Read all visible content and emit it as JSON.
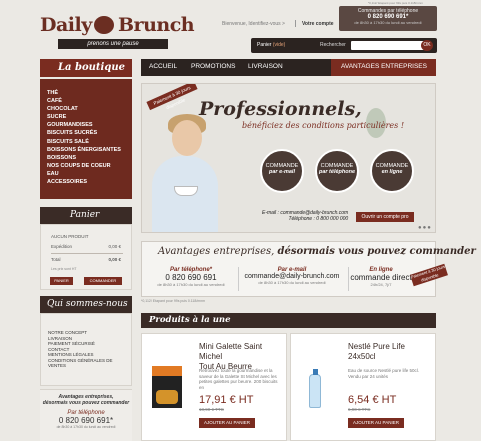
{
  "header": {
    "logo_word1": "Daily",
    "logo_word2": "Brunch",
    "logo_tagline": "prenons une pause",
    "greeting": "Bienvenue, Identifiez-vous >",
    "account_link": "Votre compte",
    "phone_box": {
      "note": "*0,112/ Etapant pour 99s puis 0.118/mnm",
      "title": "Commandes par téléphone",
      "phone": "0 820 690 691*",
      "hours": "de 8h30 à 17h30 du lundi au vendredi"
    },
    "cart_label": "Panier",
    "cart_state": "(vide)",
    "search_label": "Rechercher",
    "search_placeholder": "",
    "search_button": "OK"
  },
  "sidebar": {
    "boutique_title": "La boutique",
    "categories": [
      "THÉ",
      "CAFÉ",
      "CHOCOLAT",
      "SUCRE",
      "GOURMANDISES",
      "BISCUITS SUCRÉS",
      "BISCUITS SALÉ",
      "BOISSONS ÉNERGISANTES",
      "BOISSONS",
      "NOS COUPS DE COEUR",
      "EAU",
      "ACCESSOIRES"
    ],
    "panier_title": "Panier",
    "panier": {
      "product_line": "AUCUN PRODUIT",
      "shipping_label": "Expédition",
      "shipping_value": "0,00 €",
      "total_label": "Total",
      "total_value": "0,00 €",
      "tax_note": "Les prix sont HT",
      "btn_panier": "PANIER",
      "btn_commander": "COMMANDER"
    },
    "qui_title": "Qui sommes-nous",
    "qui_links": [
      "NOTRE CONCEPT",
      "LIVRAISON",
      "PAIEMENT SÉCURISÉ",
      "CONTACT",
      "MENTIONS LÉGALES",
      "CONDITIONS GÉNÉRALES DE",
      "VENTES"
    ],
    "adv": {
      "line1": "Avantages entreprises,",
      "line2": "désormais vous pouvez commander",
      "phone_label": "Par téléphone",
      "phone": "0 820 690 691*",
      "hours": "de 8h30 à 17h30 du lundi au vendredi"
    }
  },
  "nav": {
    "items": [
      "ACCUEIL",
      "PROMOTIONS",
      "LIVRAISON"
    ],
    "entreprises": "AVANTAGES ENTREPRISES"
  },
  "hero": {
    "ribbon": "Paiement à 30 jours disponible",
    "title": "Professionnels,",
    "subtitle": "bénéficiez des conditions particulières !",
    "circles": [
      {
        "top": "COMMANDE",
        "bottom": "par e-mail"
      },
      {
        "top": "COMMANDE",
        "bottom": "par téléphone"
      },
      {
        "top": "COMMANDE",
        "bottom": "en ligne"
      }
    ],
    "email_line": "E-mail : commande@daily-brunch.com",
    "phone_line": "Téléphone : 0 800 000 000",
    "button": "Ouvrir un compte pro",
    "dots": "●●●"
  },
  "advantages": {
    "title_part1": "Avantages entreprises,",
    "title_part2": "désormais vous pouvez commander",
    "columns": [
      {
        "label": "Par téléphone*",
        "value": "0 820 690 691",
        "sub": "de 8h30 à 17h30 du lundi au vendredi"
      },
      {
        "label": "Par e-mail",
        "value": "commande@daily-brunch.com",
        "sub": "de 8h30 à 17h30 du lundi au vendredi"
      },
      {
        "label": "En ligne",
        "value": "commande direct",
        "sub": "24h/24, 7j/7"
      }
    ],
    "note": "*0,112/ Etapant pour 99s puis 0.118/mnm",
    "badge": "Paiement à 30 jours disponible"
  },
  "products": {
    "title": "Produits à la une",
    "items": [
      {
        "name_line1": "Mini Galette Saint Michel",
        "name_line2": "Tout Au Beurre",
        "desc": "Retrouvez toute la gourmandise et la saveur de la Galette St Michel avec les petites galettes pur beurre. 200 biscuits en",
        "price": "17,91 € HT",
        "old_price": "18,90 € TTC",
        "button": "AJOUTER AU PANIER"
      },
      {
        "name_line1": "Nestlé Pure Life",
        "name_line2": "24x50cl",
        "desc": "Eau de source Nestlé pure life 50cl. Vendu par 24 unités",
        "price": "6,54 € HT",
        "old_price": "6,90 € TTC",
        "button": "AJOUTER AU PANIER"
      }
    ]
  }
}
